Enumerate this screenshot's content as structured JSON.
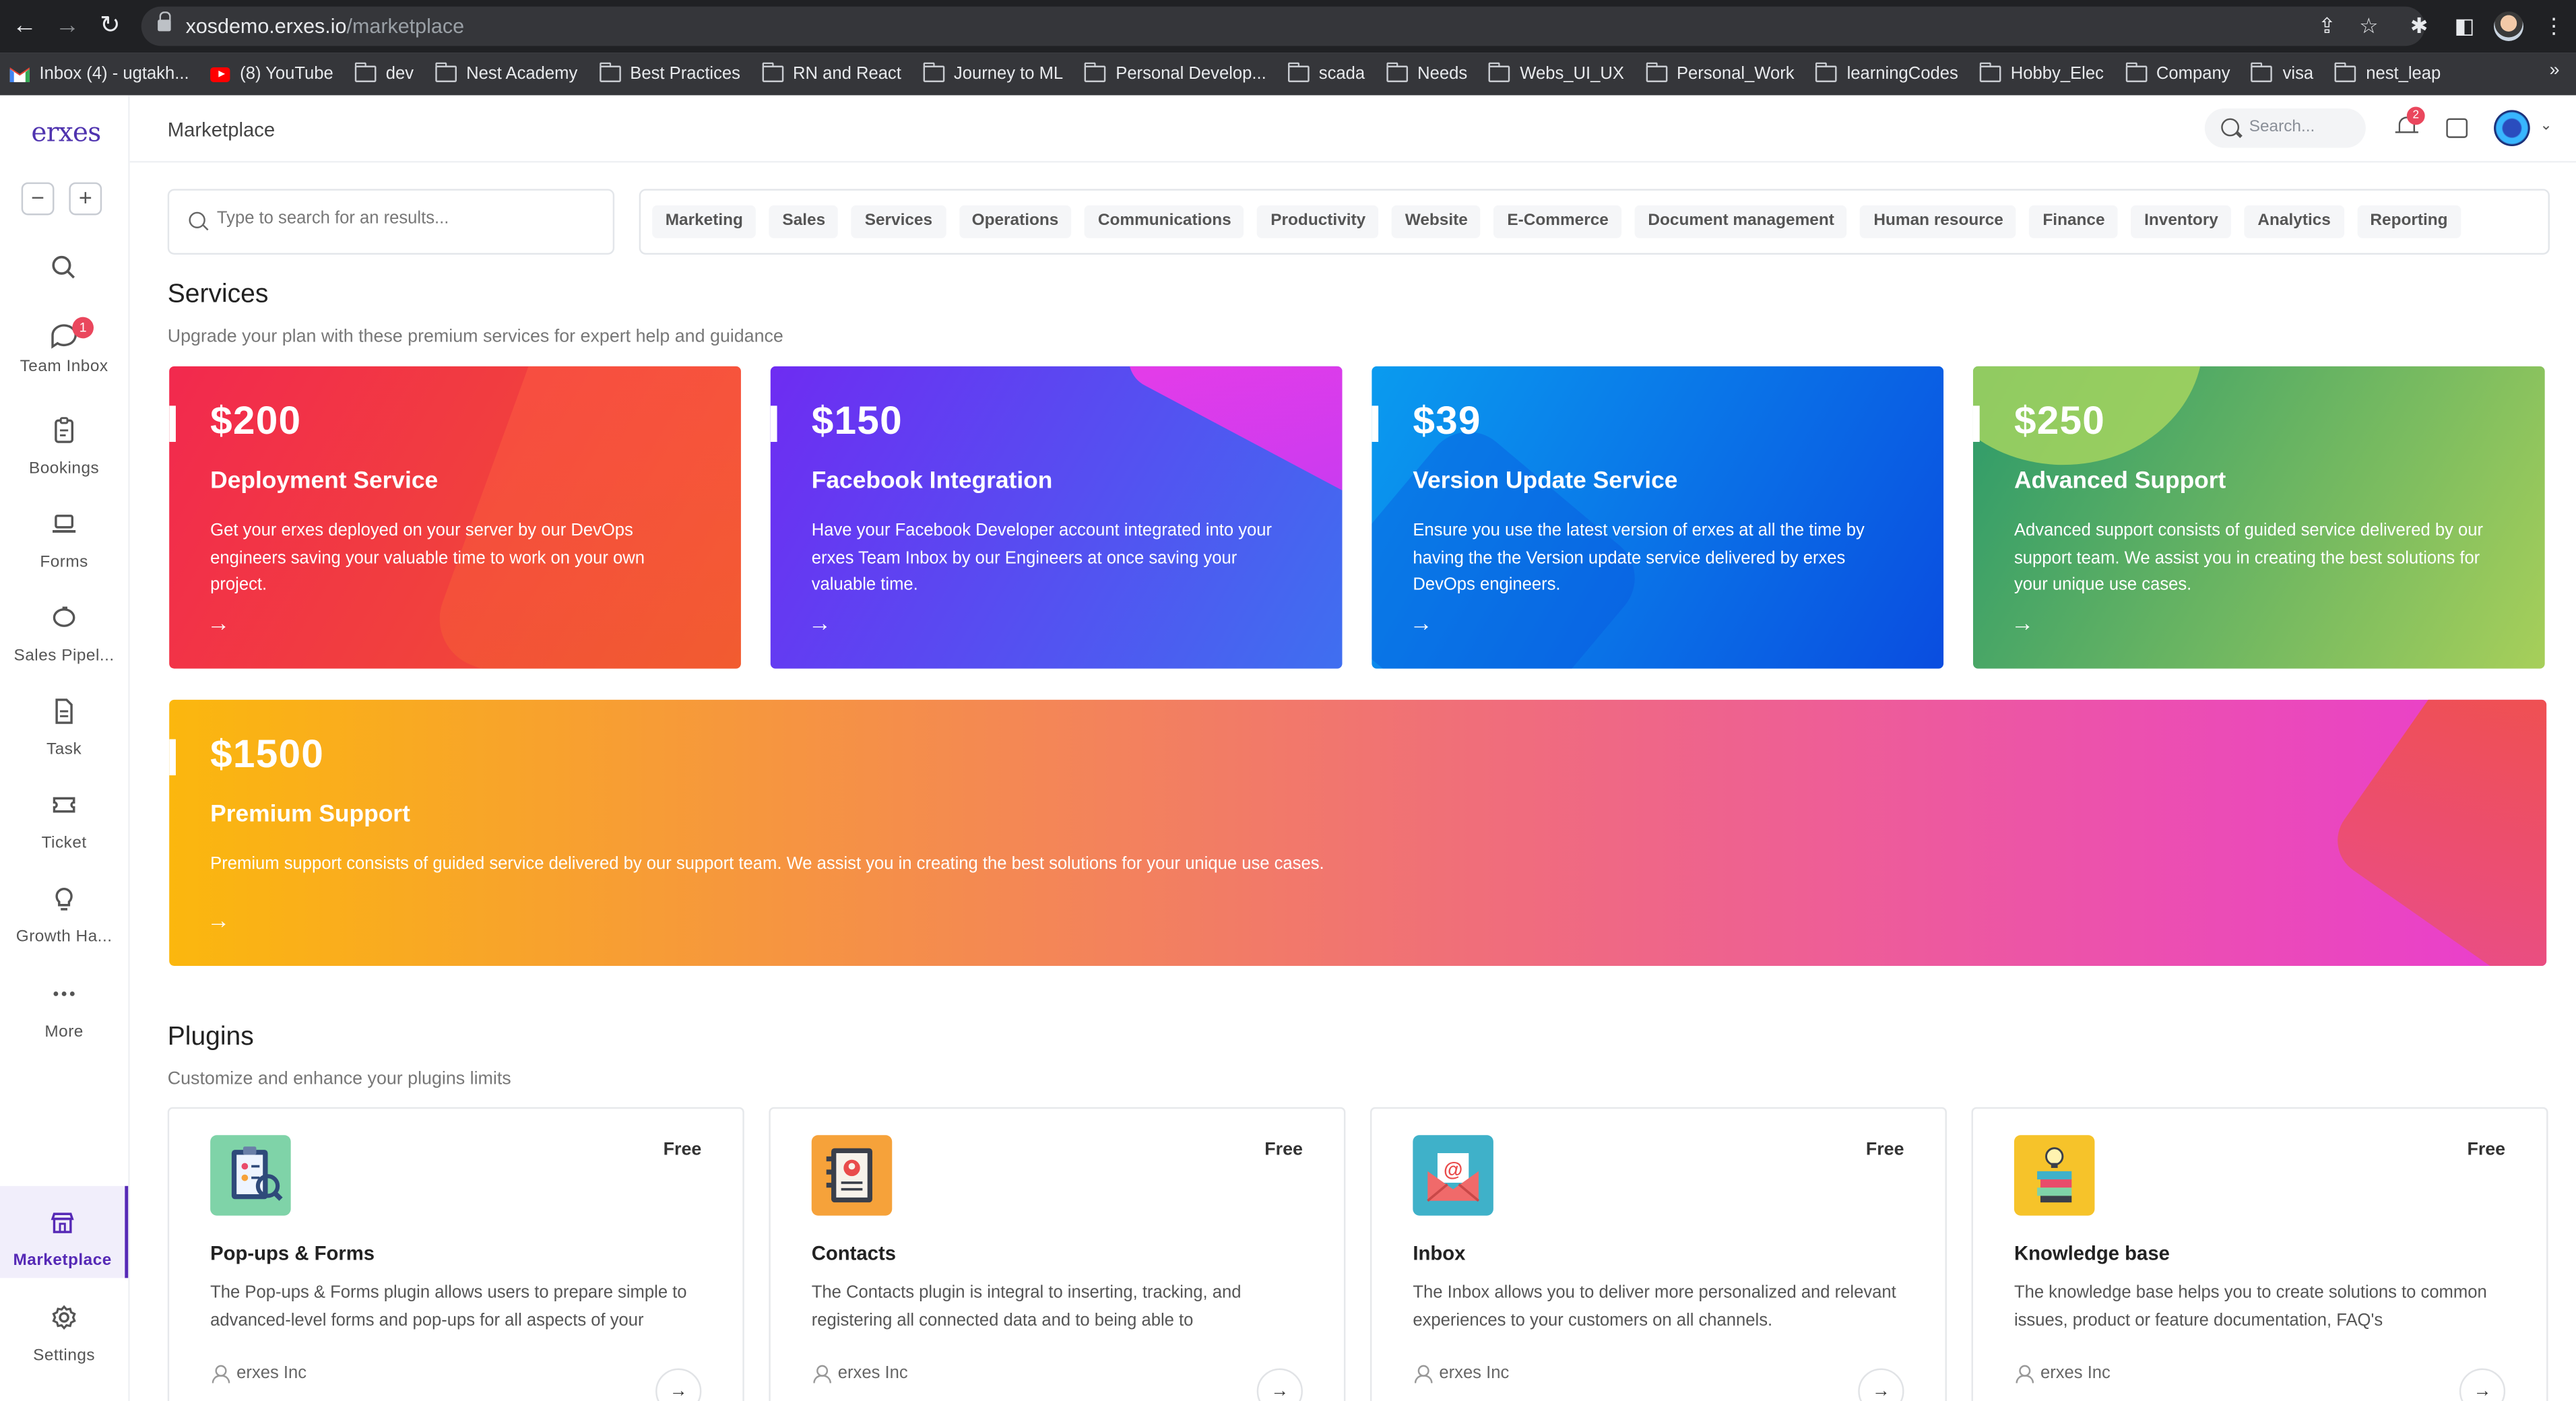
{
  "browser": {
    "url_host": "xosdemo.erxes.io",
    "url_path": "/marketplace",
    "bookmarks": [
      {
        "label": "Inbox (4) - ugtakh...",
        "icon": "gmail-icon"
      },
      {
        "label": "(8) YouTube",
        "icon": "youtube-icon"
      },
      {
        "label": "dev",
        "icon": "folder-icon"
      },
      {
        "label": "Nest Academy",
        "icon": "folder-icon"
      },
      {
        "label": "Best Practices",
        "icon": "folder-icon"
      },
      {
        "label": "RN and React",
        "icon": "folder-icon"
      },
      {
        "label": "Journey to ML",
        "icon": "folder-icon"
      },
      {
        "label": "Personal Develop...",
        "icon": "folder-icon"
      },
      {
        "label": "scada",
        "icon": "folder-icon"
      },
      {
        "label": "Needs",
        "icon": "folder-icon"
      },
      {
        "label": "Webs_UI_UX",
        "icon": "folder-icon"
      },
      {
        "label": "Personal_Work",
        "icon": "folder-icon"
      },
      {
        "label": "learningCodes",
        "icon": "folder-icon"
      },
      {
        "label": "Hobby_Elec",
        "icon": "folder-icon"
      },
      {
        "label": "Company",
        "icon": "folder-icon"
      },
      {
        "label": "visa",
        "icon": "folder-icon"
      },
      {
        "label": "nest_leap",
        "icon": "folder-icon"
      }
    ],
    "more": "»"
  },
  "sidebar": {
    "logo": "erxes",
    "zoom_out": "−",
    "zoom_in": "+",
    "items": [
      {
        "label": "Team Inbox",
        "badge": "1"
      },
      {
        "label": "Bookings"
      },
      {
        "label": "Forms"
      },
      {
        "label": "Sales Pipel..."
      },
      {
        "label": "Task"
      },
      {
        "label": "Ticket"
      },
      {
        "label": "Growth Ha..."
      },
      {
        "label": "More"
      },
      {
        "label": "Marketplace"
      },
      {
        "label": "Settings"
      }
    ]
  },
  "header": {
    "title": "Marketplace",
    "search_placeholder": "Search...",
    "notification_count": "2"
  },
  "filters": {
    "search_placeholder": "Type to search for an results...",
    "categories": [
      "Marketing",
      "Sales",
      "Services",
      "Operations",
      "Communications",
      "Productivity",
      "Website",
      "E-Commerce",
      "Document management",
      "Human resource",
      "Finance",
      "Inventory",
      "Analytics",
      "Reporting"
    ]
  },
  "services": {
    "title": "Services",
    "subtitle": "Upgrade your plan with these premium services for expert help and guidance",
    "cards": [
      {
        "price": "$200",
        "name": "Deployment Service",
        "description": "Get your erxes deployed on your server by our DevOps engineers saving your valuable time to work on your own project.",
        "colors": [
          "#f2294e",
          "#f0542f"
        ]
      },
      {
        "price": "$150",
        "name": "Facebook Integration",
        "description": "Have your Facebook Developer account integrated into your erxes Team Inbox by our Engineers at once saving your valuable time.",
        "colors": [
          "#6e2cf2",
          "#3f6ff0"
        ]
      },
      {
        "price": "$39",
        "name": "Version Update Service",
        "description": "Ensure you use the latest version of erxes  at all the time by having the the Version update service delivered by erxes DevOps engineers.",
        "colors": [
          "#0a9bef",
          "#0a4de0"
        ]
      },
      {
        "price": "$250",
        "name": "Advanced Support",
        "description": "Advanced support consists of guided service delivered by our support team. We assist you in creating the best solutions for your unique use cases.",
        "colors": [
          "#2c9a6a",
          "#a7cf5a"
        ]
      }
    ],
    "premium": {
      "price": "$1500",
      "name": "Premium Support",
      "description": "Premium support consists of guided service delivered by our support team. We assist you in creating the best solutions for your unique use cases.",
      "colors": [
        "#fbb70e",
        "#f06e7a",
        "#e93dd0"
      ]
    },
    "arrow": "→"
  },
  "plugins": {
    "title": "Plugins",
    "subtitle": "Customize and enhance your plugins limits",
    "cards": [
      {
        "name": "Pop-ups & Forms",
        "price": "Free",
        "description": "The Pop-ups & Forms plugin allows users to prepare simple to advanced-level forms and pop-ups for all aspects of your",
        "vendor": "erxes Inc",
        "icon": "form-clipboard-icon",
        "icon_bg": "#7fd3a8"
      },
      {
        "name": "Contacts",
        "price": "Free",
        "description": "The Contacts plugin is integral to inserting, tracking, and registering all connected data and to being able to",
        "vendor": "erxes Inc",
        "icon": "address-book-icon",
        "icon_bg": "#f6a23a"
      },
      {
        "name": "Inbox",
        "price": "Free",
        "description": "The Inbox allows you to deliver more personalized and relevant experiences to your customers on all channels.",
        "vendor": "erxes Inc",
        "icon": "email-envelope-icon",
        "icon_bg": "#3fb1c9"
      },
      {
        "name": "Knowledge base",
        "price": "Free",
        "description": "The knowledge base helps you to create solutions to common issues, product or feature documentation, FAQ's",
        "vendor": "erxes Inc",
        "icon": "books-lightbulb-icon",
        "icon_bg": "#f6c32a"
      }
    ],
    "go": "→"
  }
}
